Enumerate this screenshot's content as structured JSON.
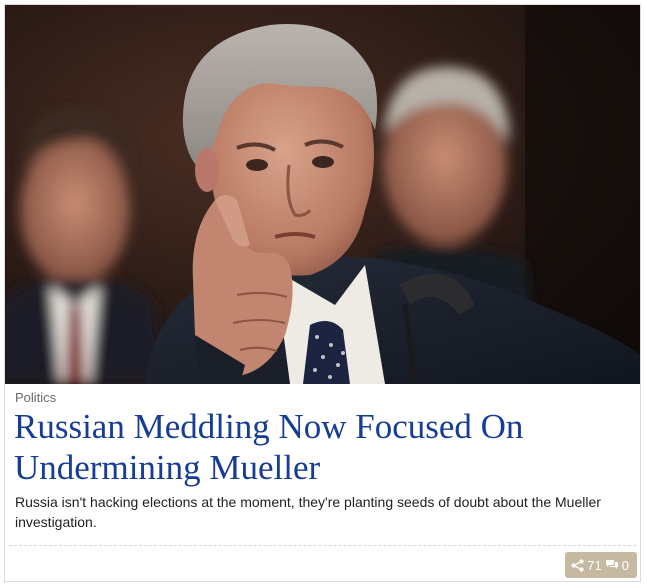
{
  "article": {
    "category": "Politics",
    "headline": "Russian Meddling Now Focused On Undermining Mueller",
    "summary": "Russia isn't hacking elections at the moment, they're planting seeds of doubt about the Mueller investigation.",
    "image_alt": "Robert Mueller with hand on chin at a hearing"
  },
  "stats": {
    "shares": "71",
    "comments": "0",
    "share_icon": "share-icon",
    "comment_icon": "comment-icon"
  },
  "colors": {
    "headline": "#163c96",
    "badge_bg": "#c6b9a2"
  }
}
